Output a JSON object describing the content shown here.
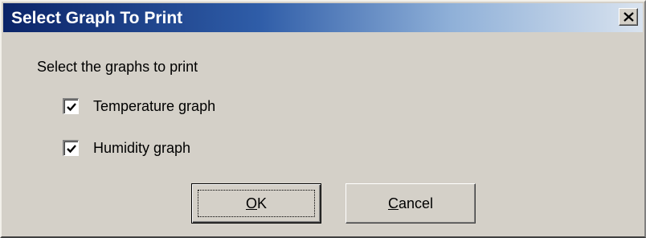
{
  "dialog": {
    "title": "Select Graph To Print",
    "prompt": "Select the graphs to print",
    "close_icon": "close-icon"
  },
  "options": [
    {
      "label": "Temperature graph",
      "checked": true
    },
    {
      "label": "Humidity graph",
      "checked": true
    }
  ],
  "buttons": {
    "ok_mnemonic": "O",
    "ok_rest": "K",
    "cancel_mnemonic": "C",
    "cancel_rest": "ancel"
  },
  "colors": {
    "titlebar_start": "#0b2468",
    "titlebar_end": "#d9e3ef",
    "window_face": "#d4d0c8"
  }
}
